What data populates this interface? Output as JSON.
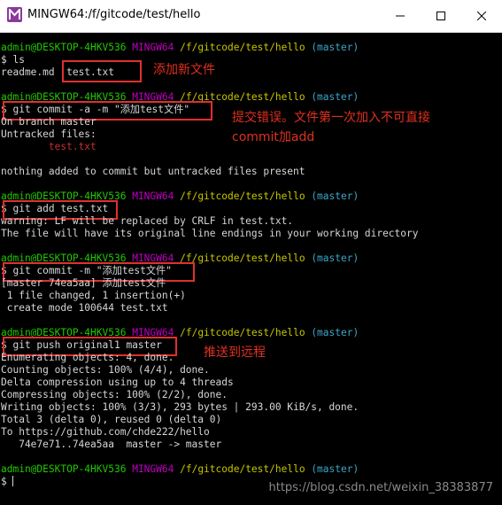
{
  "window": {
    "title": "MINGW64:/f/gitcode/test/hello",
    "icon": "mingw-logo-icon",
    "controls": [
      "minimize-icon",
      "maximize-icon",
      "close-icon"
    ]
  },
  "prompt": {
    "user_host": "admin@DESKTOP-4HKV536",
    "env": "MINGW64",
    "path": "/f/gitcode/test/hello",
    "branch": "(master)"
  },
  "blocks": [
    {
      "command": "$ ls",
      "output": [
        {
          "text": "readme.md  ",
          "extra": "test.txt"
        }
      ],
      "annotation": "添加新文件"
    },
    {
      "command": "$ git commit -a -m \"添加test文件\"",
      "output": [
        {
          "text": "On branch master"
        },
        {
          "text": "Untracked files:"
        },
        {
          "text": "        ",
          "extra": "test.txt"
        },
        {
          "text": ""
        },
        {
          "text": "nothing added to commit but untracked files present"
        }
      ],
      "annotation_lines": [
        "提交错误。文件第一次加入不可直接",
        "commit加add"
      ]
    },
    {
      "command": "$ git add test.txt",
      "output": [
        {
          "text": "warning: LF will be replaced by CRLF in test.txt."
        },
        {
          "text": "The file will have its original line endings in your working directory"
        }
      ]
    },
    {
      "command": "$ git commit -m \"添加test文件\"",
      "output": [
        {
          "text": "[master 74ea5aa] 添加test文件"
        },
        {
          "text": " 1 file changed, 1 insertion(+)"
        },
        {
          "text": " create mode 100644 test.txt"
        }
      ]
    },
    {
      "command": "$ git push original1 master",
      "output": [
        {
          "text": "Enumerating objects: 4, done."
        },
        {
          "text": "Counting objects: 100% (4/4), done."
        },
        {
          "text": "Delta compression using up to 4 threads"
        },
        {
          "text": "Compressing objects: 100% (2/2), done."
        },
        {
          "text": "Writing objects: 100% (3/3), 293 bytes | 293.00 KiB/s, done."
        },
        {
          "text": "Total 3 (delta 0), reused 0 (delta 0)"
        },
        {
          "text": "To https://github.com/chde222/hello"
        },
        {
          "text": "   74e7e71..74ea5aa  master -> master"
        }
      ],
      "annotation": "推送到远程"
    },
    {
      "command": "$ "
    }
  ],
  "watermark": "https://blog.csdn.net/weixin_38383877",
  "colors": {
    "terminal_bg": "#000000",
    "prompt_user": "#21c800",
    "prompt_env": "#c000c0",
    "prompt_path": "#c5c500",
    "prompt_branch": "#3aa6c9",
    "untracked": "#c23030",
    "annotation": "#e0301f"
  }
}
